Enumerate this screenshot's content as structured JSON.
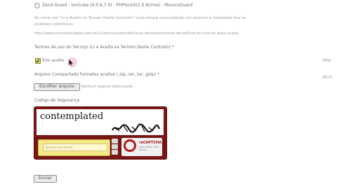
{
  "top_option": {
    "label": "Zend Guard - IonCube (6.0.6,7.0) - PHPlockit(2.0 Acima) - MavorsGuard"
  },
  "notice": {
    "line1": "Ao clicar em \"Li e Aceito os Termos Deste Contrato\" você estará concordando em assumir a totalidade dos te",
    "line2": "endereço eletrônico:",
    "url": "http://www.consultenidigital.com.br/v2/servicos/decodificacao-desenvolvimento-decodificar-de-click-an-atipu-ro-php"
  },
  "terms": {
    "title": "Termos de uso do Serviço (Li e Aceito os Termos Deste Contrato) *",
    "checkbox_label": "Sim aceito",
    "right_hint": "/Mia"
  },
  "upload": {
    "label": "Arquivo Compactado formatos aceitos (.zip,.rar,.tar,.gzip) *",
    "button": "Escolher arquivo",
    "status": "Nenhum arquivo selecionado",
    "right_hint": "/Arm"
  },
  "security": {
    "label": "Codigo de Segurança",
    "captcha_word": "contemplated",
    "input_placeholder": "Type the two words:",
    "brand": "reCAPTCHA",
    "brand_sub": "stop spam. read books."
  },
  "submit": {
    "button": "Enviar"
  },
  "colors": {
    "captcha_frame": "#7a1515",
    "input_yellow": "#f6ea86",
    "checkbox": "#d4d36a"
  }
}
